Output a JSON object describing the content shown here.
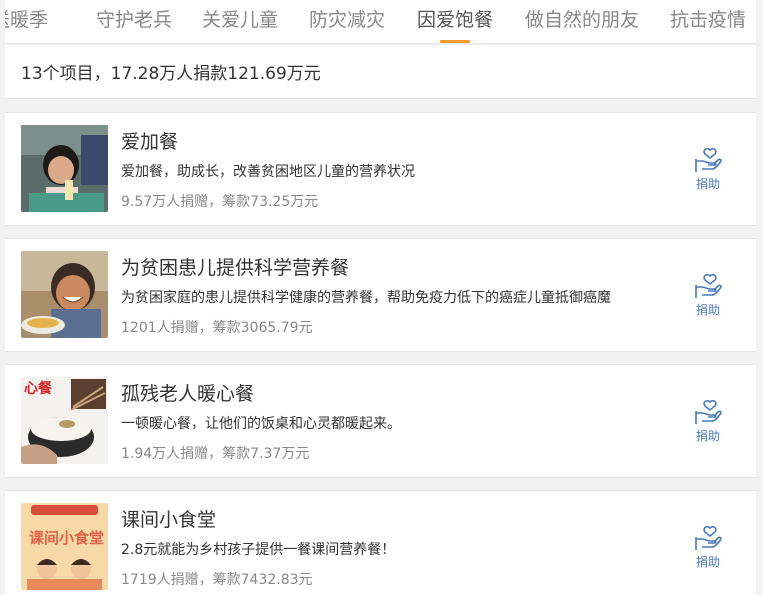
{
  "tabs": [
    {
      "label": "送暖季"
    },
    {
      "label": "守护老兵"
    },
    {
      "label": "关爱儿童"
    },
    {
      "label": "防灾减灾"
    },
    {
      "label": "因爱饱餐"
    },
    {
      "label": "做自然的朋友"
    },
    {
      "label": "抗击疫情"
    }
  ],
  "active_tab": "因爱饱餐",
  "summary": "13个项目，17.28万人捐款121.69万元",
  "projects": [
    {
      "title": "爱加餐",
      "desc": "爱加餐，助成长，改善贫困地区儿童的营养状况",
      "stats": "9.57万人捐赠，筹款73.25万元",
      "donate_label": "捐助"
    },
    {
      "title": "为贫困患儿提供科学营养餐",
      "desc": "为贫困家庭的患儿提供科学健康的营养餐，帮助免疫力低下的癌症儿童抵御癌魔",
      "stats": "1201人捐赠，筹款3065.79元",
      "donate_label": "捐助"
    },
    {
      "title": "孤残老人暖心餐",
      "desc": "一顿暖心餐，让他们的饭桌和心灵都暖起来。",
      "stats": "1.94万人捐赠，筹款7.37万元",
      "donate_label": "捐助",
      "image_text": "心餐"
    },
    {
      "title": "课间小食堂",
      "desc": "2.8元就能为乡村孩子提供一餐课间营养餐！",
      "stats": "1719人捐赠，筹款7432.83元",
      "donate_label": "捐助",
      "image_text": "课间小食堂"
    }
  ],
  "colors": {
    "accent": "#f39a2b",
    "donate": "#4a7ab8",
    "muted": "#888888"
  },
  "icons": {
    "donate": "hand-heart-icon"
  }
}
